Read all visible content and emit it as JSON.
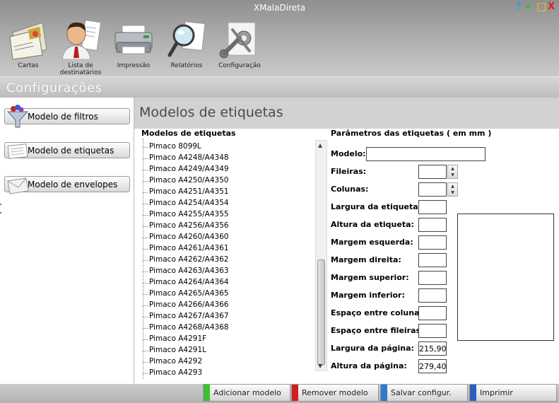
{
  "app": {
    "title": "XMalaDireta"
  },
  "toolbar": [
    {
      "label": "Cartas",
      "icon": "envelope-letters-icon"
    },
    {
      "label": "Lista de destinatários",
      "icon": "person-recipients-icon"
    },
    {
      "label": "Impressão",
      "icon": "printer-icon"
    },
    {
      "label": "Relatórios",
      "icon": "magnifier-report-icon"
    },
    {
      "label": "Configuração",
      "icon": "wrench-settings-icon"
    }
  ],
  "section": {
    "title": "Configurações"
  },
  "sidebar": [
    {
      "label": "Modelo de filtros",
      "icon": "filter-funnel-icon"
    },
    {
      "label": "Modelo de etiquetas",
      "icon": "labels-sheet-icon"
    },
    {
      "label": "Modelo de envelopes",
      "icon": "envelope-icon"
    }
  ],
  "main": {
    "title": "Modelos de etiquetas"
  },
  "list": {
    "heading": "Modelos de etiquetas",
    "items": [
      "Pimaco 8099L",
      "Pimaco A4248/A4348",
      "Pimaco A4249/A4349",
      "Pimaco A4250/A4350",
      "Pimaco A4251/A4351",
      "Pimaco A4254/A4354",
      "Pimaco A4255/A4355",
      "Pimaco A4256/A4356",
      "Pimaco A4260/A4360",
      "Pimaco A4261/A4361",
      "Pimaco A4262/A4362",
      "Pimaco A4263/A4363",
      "Pimaco A4264/A4364",
      "Pimaco A4265/A4365",
      "Pimaco A4266/A4366",
      "Pimaco A4267/A4367",
      "Pimaco A4268/A4368",
      "Pimaco A4291F",
      "Pimaco A4291L",
      "Pimaco A4292",
      "Pimaco A4293"
    ]
  },
  "params": {
    "heading": "Parâmetros das etiquetas  ( em mm )",
    "modelo_label": "Modelo:",
    "modelo_value": "",
    "fields": [
      {
        "label": "Fileiras:",
        "value": "",
        "spinner": true
      },
      {
        "label": "Colunas:",
        "value": "",
        "spinner": true
      },
      {
        "label": "Largura da etiqueta:",
        "value": ""
      },
      {
        "label": "Altura da etiqueta:",
        "value": ""
      },
      {
        "label": "Margem esquerda:",
        "value": ""
      },
      {
        "label": "Margem direita:",
        "value": ""
      },
      {
        "label": "Margem superior:",
        "value": ""
      },
      {
        "label": "Margem inferior:",
        "value": ""
      },
      {
        "label": "Espaço entre colunas:",
        "value": ""
      },
      {
        "label": "Espaço entre fileiras:",
        "value": ""
      },
      {
        "label": "Largura da página:",
        "value": "215,90"
      },
      {
        "label": "Altura da página:",
        "value": "279,40"
      }
    ]
  },
  "actions": [
    {
      "label": "Adicionar modelo",
      "color": "#3fbf2f"
    },
    {
      "label": "Remover modelo",
      "color": "#d11f1f"
    },
    {
      "label": "Salvar configur.",
      "color": "#2f79d1"
    },
    {
      "label": "Imprimir",
      "color": "#2a5fc0"
    }
  ],
  "window_controls": {
    "help": "?",
    "minimize": "↙",
    "maximize": "□",
    "close": "X"
  }
}
